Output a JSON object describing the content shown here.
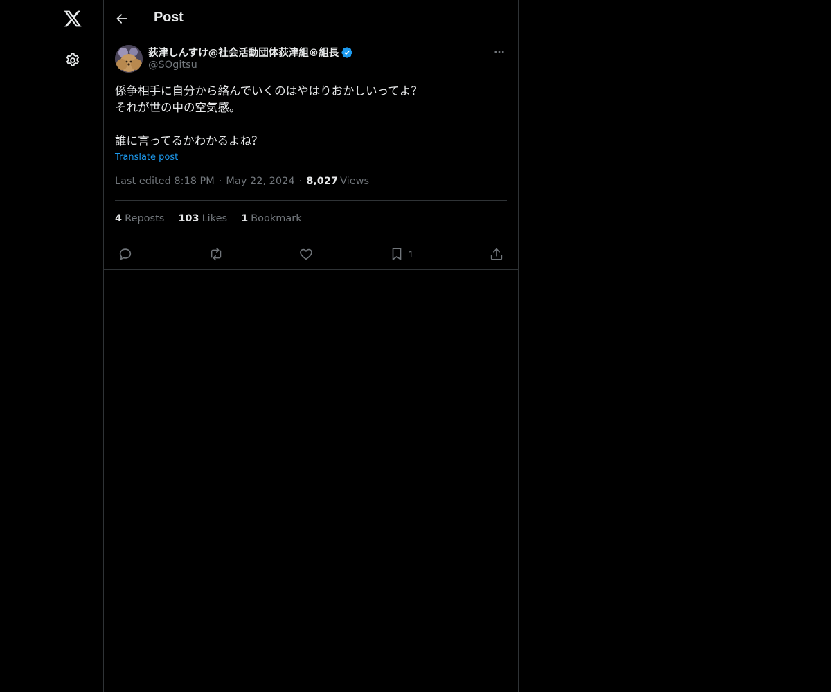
{
  "sidebar": {
    "logo_icon": "x-logo-icon",
    "settings_icon": "gear-icon"
  },
  "header": {
    "title": "Post",
    "back_icon": "arrow-left-icon"
  },
  "post": {
    "author_name": "荻津しんすけ@社会活動団体荻津組®組長",
    "handle": "@SOgitsu",
    "verified_color": "#1d9bf0",
    "text": "係争相手に自分から絡んでいくのはやはりおかしいってよ？\nそれが世の中の空気感。\n\n誰に言ってるかわかるよね？",
    "translate_label": "Translate post",
    "edited_time": "Last edited 8:18 PM",
    "date": "May 22, 2024",
    "dot": "·",
    "views_count": "8,027",
    "views_label": "Views"
  },
  "stats": {
    "reposts_count": "4",
    "reposts_label": "Reposts",
    "likes_count": "103",
    "likes_label": "Likes",
    "bookmarks_count": "1",
    "bookmarks_label": "Bookmark"
  },
  "actions": {
    "reply_icon": "reply-icon",
    "repost_icon": "repost-icon",
    "like_icon": "heart-icon",
    "bookmark_icon": "bookmark-icon",
    "bookmark_count": "1",
    "share_icon": "share-icon"
  },
  "colors": {
    "background": "#000000",
    "text_primary": "#e7e9ea",
    "text_secondary": "#71767b",
    "accent": "#1d9bf0",
    "border": "#2f3336"
  }
}
